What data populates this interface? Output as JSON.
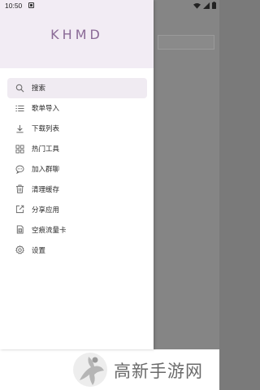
{
  "status_bar": {
    "time": "10:50"
  },
  "drawer": {
    "title": "KHMD",
    "items": [
      {
        "label": "搜索",
        "icon": "search-icon",
        "active": true
      },
      {
        "label": "歌单导入",
        "icon": "list-icon"
      },
      {
        "label": "下载列表",
        "icon": "download-icon"
      },
      {
        "label": "热门工具",
        "icon": "grid-icon"
      },
      {
        "label": "加入群聊",
        "icon": "chat-icon"
      },
      {
        "label": "清理缓存",
        "icon": "trash-icon"
      },
      {
        "label": "分享应用",
        "icon": "share-icon"
      },
      {
        "label": "空痕流量卡",
        "icon": "sim-card-icon"
      },
      {
        "label": "设置",
        "icon": "gear-icon"
      }
    ]
  },
  "watermark": {
    "text": "高新手游网"
  },
  "colors": {
    "accent": "#8a6a96",
    "header_bg": "#f2ecf4",
    "active_bg": "#f0ebf2"
  }
}
